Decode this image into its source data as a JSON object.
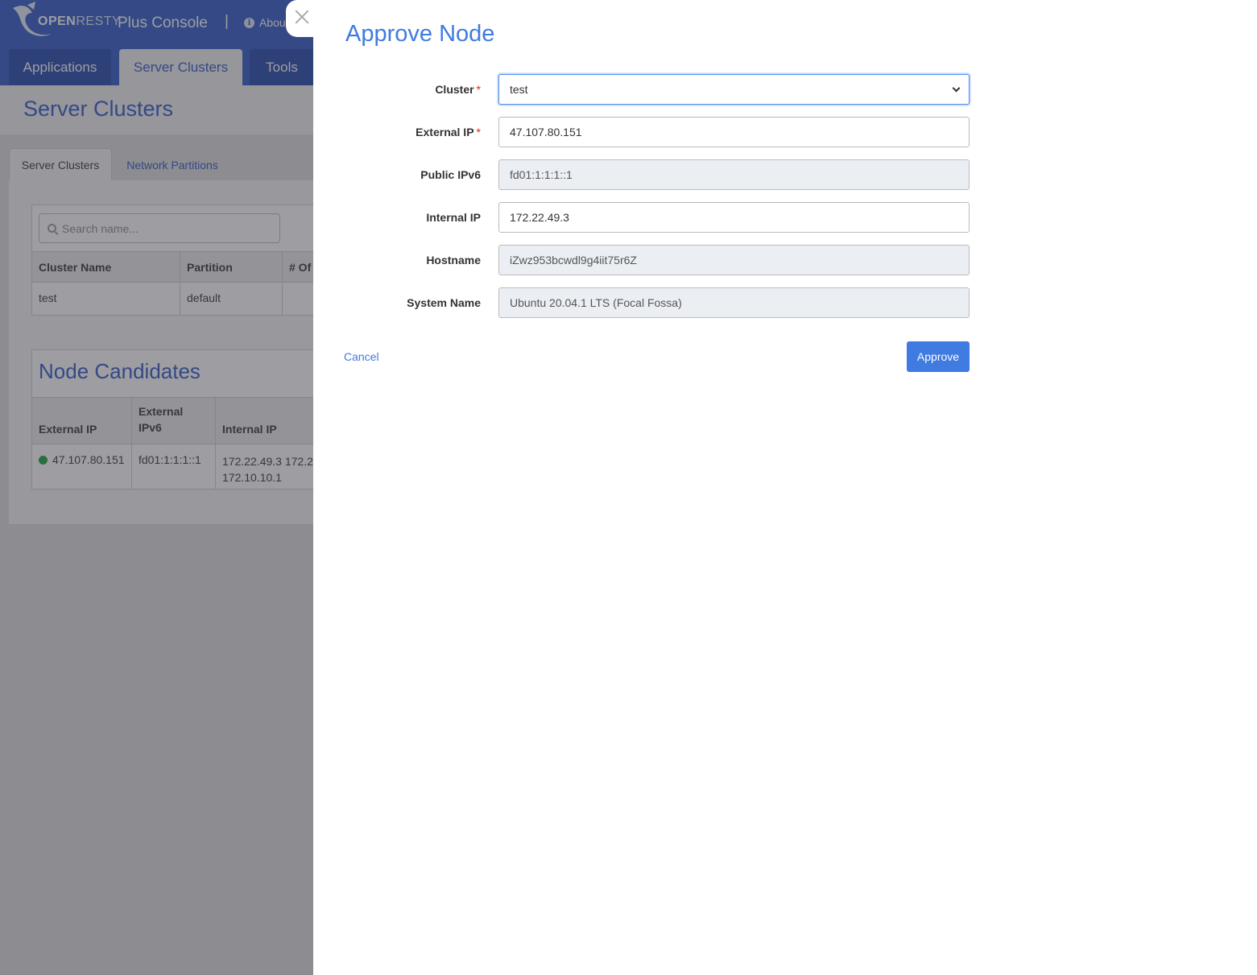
{
  "header": {
    "logo_open": "OPEN",
    "logo_resty": "RESTY",
    "console_title": "Plus Console",
    "separator": "|",
    "about_label": "About"
  },
  "main_tabs": [
    {
      "label": "Applications",
      "active": false
    },
    {
      "label": "Server Clusters",
      "active": true
    },
    {
      "label": "Tools",
      "active": false
    }
  ],
  "page_title": "Server Clusters",
  "sub_tabs": [
    {
      "label": "Server Clusters",
      "active": true
    },
    {
      "label": "Network Partitions",
      "active": false
    }
  ],
  "search": {
    "placeholder": "Search name..."
  },
  "clusters_table": {
    "headers": [
      "Cluster Name",
      "Partition",
      "# Of"
    ],
    "rows": [
      {
        "cluster_name": "test",
        "partition": "default"
      }
    ]
  },
  "node_candidates": {
    "title": "Node Candidates",
    "headers": [
      "External IP",
      "External IPv6",
      "Internal IP"
    ],
    "rows": [
      {
        "status": "online",
        "external_ip": "47.107.80.151",
        "external_ipv6": "fd01:1:1:1::1",
        "internal_ip": "172.22.49.3",
        "internal_ip_2": "172.10.10.1",
        "cutoff": "172.2"
      }
    ]
  },
  "drawer": {
    "title": "Approve Node",
    "fields": {
      "cluster": {
        "label": "Cluster",
        "required": true,
        "value": "test"
      },
      "external_ip": {
        "label": "External IP",
        "required": true,
        "value": "47.107.80.151"
      },
      "public_ipv6": {
        "label": "Public IPv6",
        "value": "fd01:1:1:1::1",
        "readonly": true
      },
      "internal_ip": {
        "label": "Internal IP",
        "value": "172.22.49.3"
      },
      "hostname": {
        "label": "Hostname",
        "value": "iZwz953bcwdl9g4iit75r6Z",
        "readonly": true
      },
      "system_name": {
        "label": "System Name",
        "value": "Ubuntu 20.04.1 LTS (Focal Fossa)",
        "readonly": true
      }
    },
    "cancel_label": "Cancel",
    "approve_label": "Approve",
    "required_mark": "*"
  },
  "colors": {
    "brand": "#2c57c5",
    "accent": "#3f7be0",
    "status_online": "#1aa33a",
    "required": "#dd2222"
  }
}
